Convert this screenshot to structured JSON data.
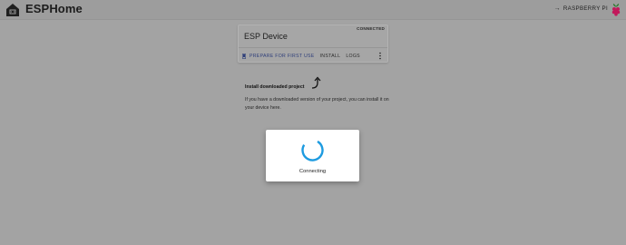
{
  "header": {
    "title": "ESPHome",
    "logo_icon": "home-logo-icon",
    "host_link_label": "RASPBERRY PI",
    "host_arrow_icon": "arrow-right-icon",
    "board_icon": "raspberry-pi-icon"
  },
  "device_card": {
    "name": "ESP Device",
    "status": "CONNECTED",
    "actions": {
      "prepare_label": "PREPARE FOR FIRST USE",
      "prepare_icon": "phone-icon",
      "install_label": "INSTALL",
      "logs_label": "LOGS",
      "menu_icon": "more-vert-icon"
    }
  },
  "install_section": {
    "title": "Install downloaded project",
    "arrow_icon": "curved-arrow-icon",
    "description": "If you have a downloaded version of your project, you can install it on your device here."
  },
  "dialog": {
    "message": "Connecting",
    "spinner_icon": "loading-spinner-icon"
  },
  "colors": {
    "primary": "#2f3f7a",
    "spinner": "#1d9be0",
    "overlay": "#a3a3a3"
  }
}
